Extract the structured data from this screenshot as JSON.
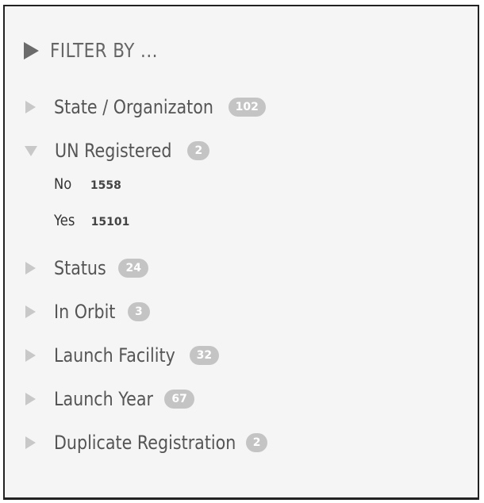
{
  "filter": {
    "title": "FILTER BY ...",
    "items": [
      {
        "label": "State / Organizaton",
        "count": "102",
        "expanded": false
      },
      {
        "label": "UN Registered",
        "count": "2",
        "expanded": true,
        "options": [
          {
            "label": "No",
            "count": "1558"
          },
          {
            "label": "Yes",
            "count": "15101"
          }
        ]
      },
      {
        "label": "Status",
        "count": "24",
        "expanded": false
      },
      {
        "label": "In Orbit",
        "count": "3",
        "expanded": false
      },
      {
        "label": "Launch Facility",
        "count": "32",
        "expanded": false
      },
      {
        "label": "Launch Year",
        "count": "67",
        "expanded": false
      },
      {
        "label": "Duplicate Registration",
        "count": "2",
        "expanded": false
      }
    ]
  },
  "colors": {
    "badge": "#c4c4c4",
    "caret": "#c8c8c8",
    "header_arrow": "#6b6b6b",
    "panel_bg": "#f5f5f5"
  }
}
